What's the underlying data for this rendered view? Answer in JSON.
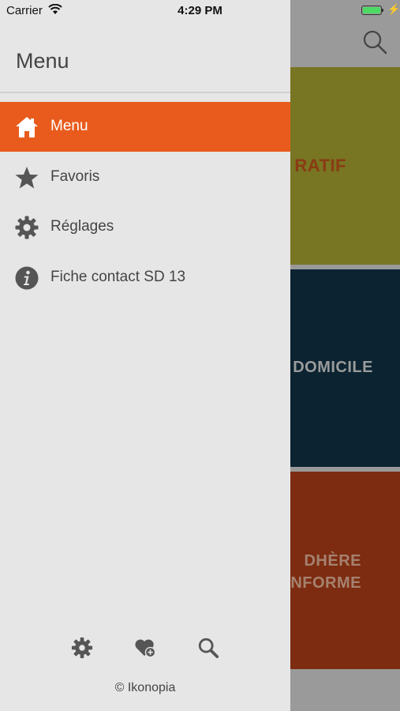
{
  "status_bar": {
    "carrier": "Carrier",
    "time": "4:29 PM"
  },
  "background": {
    "tiles": [
      {
        "label": "RATIF",
        "color": "#787523"
      },
      {
        "label": "DOMICILE",
        "color": "#0c2331"
      },
      {
        "label_lines": [
          "DHÈRE",
          "INFORME"
        ],
        "color": "#7d2c11"
      }
    ],
    "search_icon": "search-icon"
  },
  "drawer": {
    "title": "Menu",
    "items": [
      {
        "label": "Menu",
        "icon": "home-icon",
        "active": true
      },
      {
        "label": "Favoris",
        "icon": "star-icon",
        "active": false
      },
      {
        "label": "Réglages",
        "icon": "gear-icon",
        "active": false
      },
      {
        "label": "Fiche contact SD 13",
        "icon": "info-icon",
        "active": false
      }
    ],
    "footer_icons": [
      "gear-icon",
      "heart-plus-icon",
      "search-icon"
    ],
    "copyright": "© Ikonopia"
  },
  "colors": {
    "accent": "#e85b1c",
    "drawer_bg": "#e6e6e6",
    "icon_gray": "#555555"
  }
}
